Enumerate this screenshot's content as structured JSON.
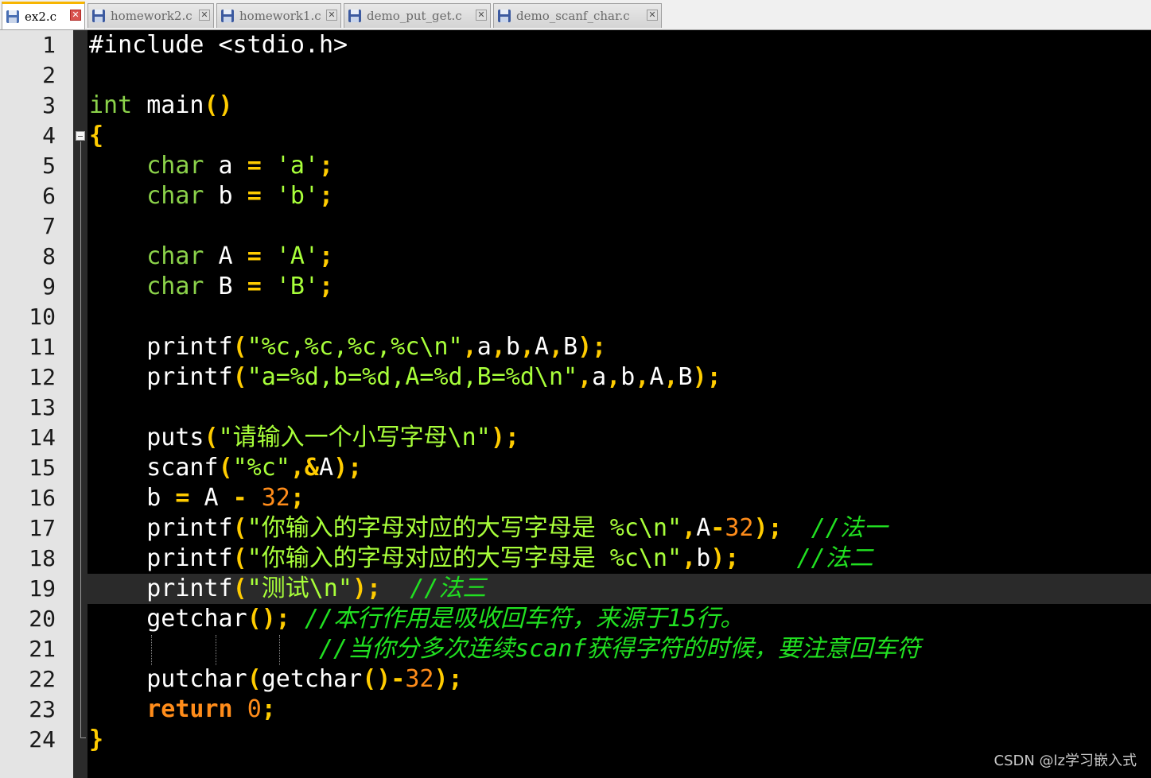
{
  "tabs": [
    {
      "label": "ex2.c",
      "active": true
    },
    {
      "label": "homework2.c",
      "active": false
    },
    {
      "label": "homework1.c",
      "active": false
    },
    {
      "label": "demo_put_get.c",
      "active": false
    },
    {
      "label": "demo_scanf_char.c",
      "active": false
    }
  ],
  "editor": {
    "current_line": 19,
    "lines": [
      {
        "n": "1",
        "tokens": [
          [
            "plain",
            "#include <stdio.h>"
          ]
        ]
      },
      {
        "n": "2",
        "tokens": []
      },
      {
        "n": "3",
        "tokens": [
          [
            "type",
            "int"
          ],
          [
            "plain",
            " main"
          ],
          [
            "op",
            "()"
          ]
        ]
      },
      {
        "n": "4",
        "tokens": [
          [
            "op",
            "{"
          ]
        ]
      },
      {
        "n": "5",
        "tokens": [
          [
            "plain",
            "    "
          ],
          [
            "type",
            "char"
          ],
          [
            "plain",
            " a "
          ],
          [
            "op",
            "="
          ],
          [
            "plain",
            " "
          ],
          [
            "str",
            "'a'"
          ],
          [
            "op",
            ";"
          ]
        ]
      },
      {
        "n": "6",
        "tokens": [
          [
            "plain",
            "    "
          ],
          [
            "type",
            "char"
          ],
          [
            "plain",
            " b "
          ],
          [
            "op",
            "="
          ],
          [
            "plain",
            " "
          ],
          [
            "str",
            "'b'"
          ],
          [
            "op",
            ";"
          ]
        ]
      },
      {
        "n": "7",
        "tokens": []
      },
      {
        "n": "8",
        "tokens": [
          [
            "plain",
            "    "
          ],
          [
            "type",
            "char"
          ],
          [
            "plain",
            " A "
          ],
          [
            "op",
            "="
          ],
          [
            "plain",
            " "
          ],
          [
            "str",
            "'A'"
          ],
          [
            "op",
            ";"
          ]
        ]
      },
      {
        "n": "9",
        "tokens": [
          [
            "plain",
            "    "
          ],
          [
            "type",
            "char"
          ],
          [
            "plain",
            " B "
          ],
          [
            "op",
            "="
          ],
          [
            "plain",
            " "
          ],
          [
            "str",
            "'B'"
          ],
          [
            "op",
            ";"
          ]
        ]
      },
      {
        "n": "10",
        "tokens": []
      },
      {
        "n": "11",
        "tokens": [
          [
            "plain",
            "    printf"
          ],
          [
            "op",
            "("
          ],
          [
            "str",
            "\"%c,%c,%c,%c\\n\""
          ],
          [
            "op",
            ","
          ],
          [
            "plain",
            "a"
          ],
          [
            "op",
            ","
          ],
          [
            "plain",
            "b"
          ],
          [
            "op",
            ","
          ],
          [
            "plain",
            "A"
          ],
          [
            "op",
            ","
          ],
          [
            "plain",
            "B"
          ],
          [
            "op",
            ");"
          ]
        ]
      },
      {
        "n": "12",
        "tokens": [
          [
            "plain",
            "    printf"
          ],
          [
            "op",
            "("
          ],
          [
            "str",
            "\"a=%d,b=%d,A=%d,B=%d\\n\""
          ],
          [
            "op",
            ","
          ],
          [
            "plain",
            "a"
          ],
          [
            "op",
            ","
          ],
          [
            "plain",
            "b"
          ],
          [
            "op",
            ","
          ],
          [
            "plain",
            "A"
          ],
          [
            "op",
            ","
          ],
          [
            "plain",
            "B"
          ],
          [
            "op",
            ");"
          ]
        ]
      },
      {
        "n": "13",
        "tokens": []
      },
      {
        "n": "14",
        "tokens": [
          [
            "plain",
            "    puts"
          ],
          [
            "op",
            "("
          ],
          [
            "str",
            "\"请输入一个小写字母\\n\""
          ],
          [
            "op",
            ");"
          ]
        ]
      },
      {
        "n": "15",
        "tokens": [
          [
            "plain",
            "    scanf"
          ],
          [
            "op",
            "("
          ],
          [
            "str",
            "\"%c\""
          ],
          [
            "op",
            ",&"
          ],
          [
            "plain",
            "A"
          ],
          [
            "op",
            ");"
          ]
        ]
      },
      {
        "n": "16",
        "tokens": [
          [
            "plain",
            "    b "
          ],
          [
            "op",
            "="
          ],
          [
            "plain",
            " A "
          ],
          [
            "op",
            "-"
          ],
          [
            "plain",
            " "
          ],
          [
            "num",
            "32"
          ],
          [
            "op",
            ";"
          ]
        ]
      },
      {
        "n": "17",
        "tokens": [
          [
            "plain",
            "    printf"
          ],
          [
            "op",
            "("
          ],
          [
            "str",
            "\"你输入的字母对应的大写字母是 %c\\n\""
          ],
          [
            "op",
            ","
          ],
          [
            "plain",
            "A"
          ],
          [
            "op",
            "-"
          ],
          [
            "num",
            "32"
          ],
          [
            "op",
            ");"
          ],
          [
            "plain",
            "  "
          ],
          [
            "cmt",
            "//法一"
          ]
        ]
      },
      {
        "n": "18",
        "tokens": [
          [
            "plain",
            "    printf"
          ],
          [
            "op",
            "("
          ],
          [
            "str",
            "\"你输入的字母对应的大写字母是 %c\\n\""
          ],
          [
            "op",
            ","
          ],
          [
            "plain",
            "b"
          ],
          [
            "op",
            ");"
          ],
          [
            "plain",
            "    "
          ],
          [
            "cmt",
            "//法二"
          ]
        ]
      },
      {
        "n": "19",
        "tokens": [
          [
            "plain",
            "    printf"
          ],
          [
            "op",
            "("
          ],
          [
            "str",
            "\"测试\\n\""
          ],
          [
            "op",
            ");"
          ],
          [
            "plain",
            "  "
          ],
          [
            "cmt",
            "//法三"
          ]
        ]
      },
      {
        "n": "20",
        "tokens": [
          [
            "plain",
            "    getchar"
          ],
          [
            "op",
            "();"
          ],
          [
            "plain",
            " "
          ],
          [
            "cmt",
            "//本行作用是吸收回车符，来源于15行。"
          ]
        ]
      },
      {
        "n": "21",
        "tokens": [
          [
            "plain",
            "                "
          ],
          [
            "cmt",
            "//当你分多次连续scanf获得字符的时候，要注意回车符"
          ]
        ]
      },
      {
        "n": "22",
        "tokens": [
          [
            "plain",
            "    putchar"
          ],
          [
            "op",
            "("
          ],
          [
            "plain",
            "getchar"
          ],
          [
            "op",
            "()-"
          ],
          [
            "num",
            "32"
          ],
          [
            "op",
            ");"
          ]
        ]
      },
      {
        "n": "23",
        "tokens": [
          [
            "plain",
            "    "
          ],
          [
            "kw",
            "return"
          ],
          [
            "plain",
            " "
          ],
          [
            "num",
            "0"
          ],
          [
            "op",
            ";"
          ]
        ]
      },
      {
        "n": "24",
        "tokens": [
          [
            "op",
            "}"
          ]
        ]
      }
    ]
  },
  "watermark": "CSDN @lz学习嵌入式",
  "colors": {
    "type": "#8bd24a",
    "operator": "#ffcc00",
    "string": "#a8ff3a",
    "number": "#ff8c1a",
    "keyword": "#ff8c1a",
    "comment": "#21e021",
    "active_tab_accent": "#f7b500"
  }
}
